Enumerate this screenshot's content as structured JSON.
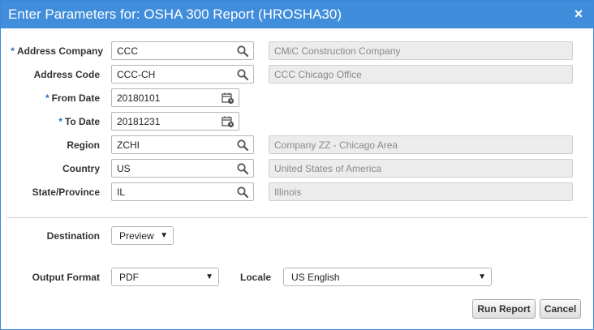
{
  "dialog": {
    "title": "Enter Parameters for: OSHA 300 Report (HROSHA30)",
    "close_symbol": "×"
  },
  "fields": [
    {
      "label": "Address Company",
      "required": true,
      "value": "CCC",
      "icon": "search-icon",
      "description": "CMiC Construction Company"
    },
    {
      "label": "Address Code",
      "required": false,
      "value": "CCC-CH",
      "icon": "search-icon",
      "description": "CCC Chicago Office"
    },
    {
      "label": "From Date",
      "required": true,
      "value": "20180101",
      "icon": "calendar-icon"
    },
    {
      "label": "To Date",
      "required": true,
      "value": "20181231",
      "icon": "calendar-icon"
    },
    {
      "label": "Region",
      "required": false,
      "value": "ZCHI",
      "icon": "search-icon",
      "description": "Company ZZ - Chicago Area"
    },
    {
      "label": "Country",
      "required": false,
      "value": "US",
      "icon": "search-icon",
      "description": "United States of America"
    },
    {
      "label": "State/Province",
      "required": false,
      "value": "IL",
      "icon": "search-icon",
      "description": "Illinois"
    }
  ],
  "required_marker": "*",
  "destination": {
    "label": "Destination",
    "value": "Preview"
  },
  "output_format": {
    "label": "Output Format",
    "value": "PDF"
  },
  "locale": {
    "label": "Locale",
    "value": "US English"
  },
  "caret_symbol": "▼",
  "buttons": {
    "run": "Run Report",
    "cancel": "Cancel"
  },
  "colors": {
    "title_bar": "#3f8ddb",
    "required_marker": "#2a6fc0",
    "readonly_bg": "#ececec",
    "readonly_text": "#8a8a8a"
  }
}
